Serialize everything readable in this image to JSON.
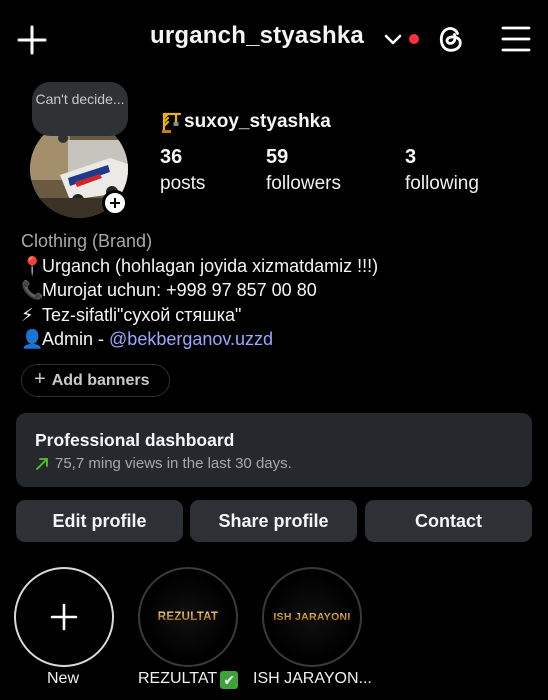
{
  "header": {
    "username": "urganch_styashka",
    "notification_dot_color": "#ff3040"
  },
  "profile": {
    "note": "Can't decide...",
    "display_name": "suxoy_styashka",
    "name_emoji": "crane-icon",
    "stats": [
      {
        "value": "36",
        "label": "posts"
      },
      {
        "value": "59",
        "label": "followers"
      },
      {
        "value": "3",
        "label": "following"
      }
    ]
  },
  "bio": {
    "category": "Clothing (Brand)",
    "lines": [
      {
        "emoji": "📍",
        "text": "Urganch (hohlagan joyida xizmatdamiz !!!)"
      },
      {
        "emoji": "📞",
        "text": "Murojat uchun: +998 97 857 00 80"
      },
      {
        "emoji": "⚡",
        "text": "Tez-sifatli\"сухой стяшка\""
      },
      {
        "emoji": "👤",
        "text": "Admin - ",
        "mention": "@bekberganov.uzzd"
      }
    ],
    "mention_color": "#9aa8ff"
  },
  "banners": {
    "label": "Add banners"
  },
  "dashboard": {
    "title": "Professional dashboard",
    "subtitle": "75,7 ming views in the last 30 days.",
    "trend_color": "#58c322"
  },
  "actions": {
    "edit": "Edit profile",
    "share": "Share profile",
    "contact": "Contact"
  },
  "highlights": [
    {
      "label": "New"
    },
    {
      "label": "REZULTAT",
      "cover_text": "REZULTAT",
      "badge": "✔"
    },
    {
      "label": "ISH JARAYON...",
      "cover_text": "ISH JARAYONI"
    }
  ]
}
